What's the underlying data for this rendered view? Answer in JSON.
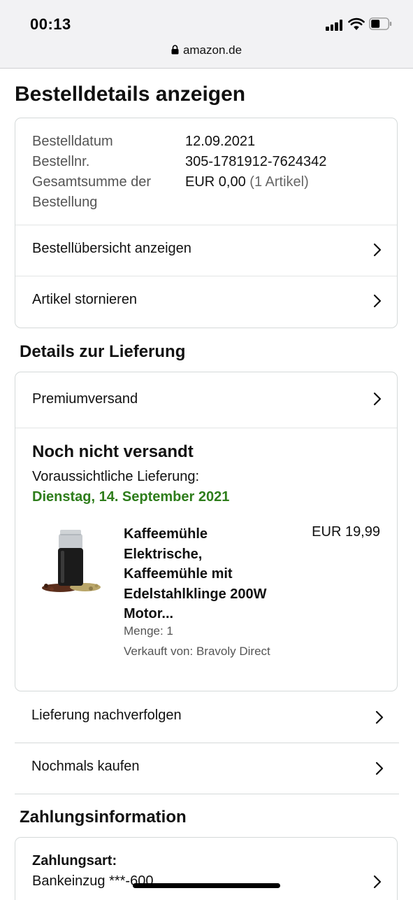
{
  "status_bar": {
    "time": "00:13",
    "url": "amazon.de"
  },
  "page_title": "Bestelldetails anzeigen",
  "order_info": {
    "rows": [
      {
        "label": "Bestelldatum",
        "value": "12.09.2021"
      },
      {
        "label": "Bestellnr.",
        "value": "305-1781912-7624342"
      }
    ],
    "total_label_line1": "Gesamtsumme der",
    "total_label_line2": "Bestellung",
    "total_value": "EUR 0,00",
    "total_count": "(1 Artikel)"
  },
  "order_actions": [
    "Bestellübersicht anzeigen",
    "Artikel stornieren"
  ],
  "delivery": {
    "heading": "Details zur Lieferung",
    "shipping_method": "Premiumversand",
    "status": "Noch nicht versandt",
    "expected_label": "Voraussichtliche Lieferung:",
    "expected_date": "Dienstag, 14. September 2021",
    "product": {
      "name_lines": [
        "Kaffeemühle",
        "Elektrische,",
        "Kaffeemühle mit",
        "Edelstahlklinge 200W",
        "Motor..."
      ],
      "price": "EUR 19,99",
      "quantity": "Menge: 1",
      "seller": "Verkauft von: Bravoly Direct"
    }
  },
  "delivery_actions": [
    "Lieferung nachverfolgen",
    "Nochmals kaufen"
  ],
  "payment": {
    "heading": "Zahlungsinformation",
    "method_label": "Zahlungsart:",
    "method_value": "Bankeinzug ***-600"
  },
  "colors": {
    "accent_green": "#2e7d1b",
    "border": "#d5d9d9",
    "statusbar_bg": "#f2f2f4"
  },
  "icons": [
    "signal-icon",
    "wifi-icon",
    "battery-icon",
    "lock-icon",
    "chevron-right-icon"
  ]
}
